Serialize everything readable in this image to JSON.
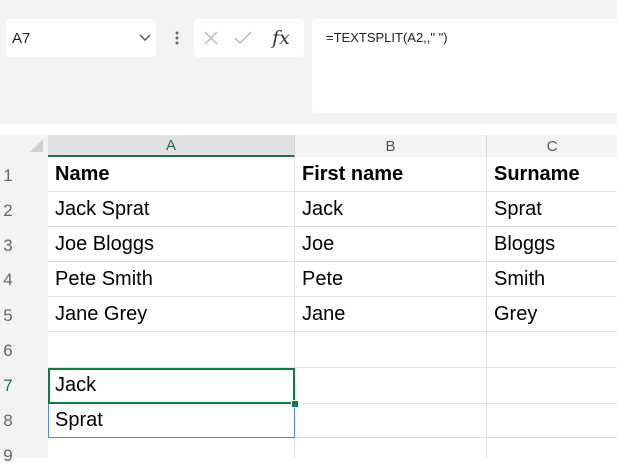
{
  "name_box": {
    "value": "A7"
  },
  "formula_bar": {
    "value": "=TEXTSPLIT(A2,,\" \")"
  },
  "fx_label": "fx",
  "columns": [
    "A",
    "B",
    "C"
  ],
  "rows": [
    {
      "num": "1",
      "cells": [
        "Name",
        "First name",
        "Surname"
      ]
    },
    {
      "num": "2",
      "cells": [
        "Jack Sprat",
        "Jack",
        "Sprat"
      ]
    },
    {
      "num": "3",
      "cells": [
        "Joe Bloggs",
        "Joe",
        "Bloggs"
      ]
    },
    {
      "num": "4",
      "cells": [
        "Pete Smith",
        "Pete",
        "Smith"
      ]
    },
    {
      "num": "5",
      "cells": [
        "Jane Grey",
        "Jane",
        "Grey"
      ]
    },
    {
      "num": "6",
      "cells": [
        "",
        "",
        ""
      ]
    },
    {
      "num": "7",
      "cells": [
        "Jack",
        "",
        ""
      ]
    },
    {
      "num": "8",
      "cells": [
        "Sprat",
        "",
        ""
      ]
    },
    {
      "num": "9",
      "cells": [
        "",
        "",
        ""
      ]
    }
  ],
  "colors": {
    "accent": "#107c41",
    "spill": "#4a86e8",
    "header_bg": "#f3f3f3"
  },
  "icons": [
    "chevron-down-icon",
    "more-options-icon",
    "cancel-x-icon",
    "enter-check-icon",
    "insert-function-icon"
  ]
}
